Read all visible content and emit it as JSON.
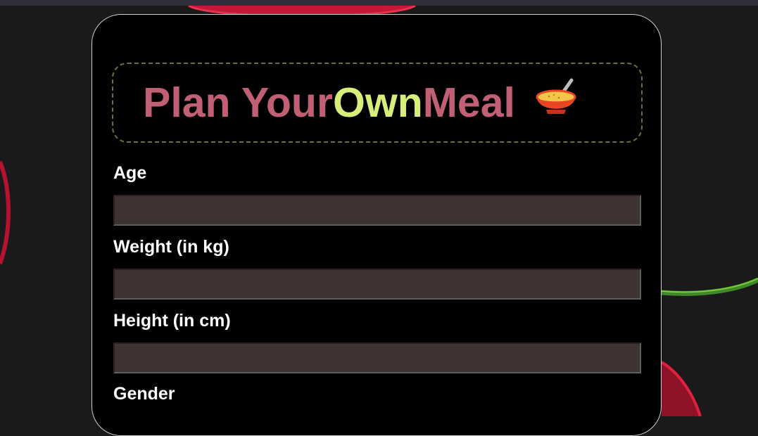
{
  "form": {
    "title_part1": "Plan Your ",
    "title_part2": "Own",
    "title_part3": " Meal",
    "title_icon": "soup-bowl-icon",
    "fields": [
      {
        "label": "Age",
        "value": ""
      },
      {
        "label": "Weight (in kg)",
        "value": ""
      },
      {
        "label": "Height (in cm)",
        "value": ""
      },
      {
        "label": "Gender"
      }
    ]
  },
  "colors": {
    "page_bg": "#1a1a1a",
    "card_bg": "#000000",
    "title_primary": "#c15f74",
    "title_accent": "#d7ee7b",
    "input_bg": "#3f3232"
  }
}
